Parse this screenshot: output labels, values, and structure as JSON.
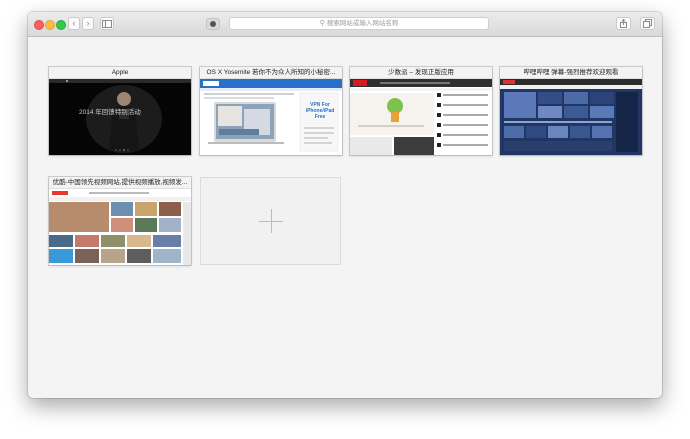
{
  "toolbar": {
    "address_placeholder": "搜索网站或输入网站名称",
    "back_glyph": "‹",
    "forward_glyph": "›"
  },
  "top_sites": [
    {
      "title": "Apple",
      "thumb_text": "2014 年回馈特别活动"
    },
    {
      "title": "OS X Yosemite 若你不为众人所知的小秘密...",
      "thumb_text": "VPN For iPhone/iPad Free"
    },
    {
      "title": "少数派 – 发现正版应用",
      "thumb_text": ""
    },
    {
      "title": "哔哩哔哩 弹幕-强烈推荐欢迎观看",
      "thumb_text": ""
    },
    {
      "title": "优酷-中国领先视频网站,提供视频播放,视频发...",
      "thumb_text": ""
    }
  ],
  "colors": {
    "window_bg": "#f4f4f4",
    "toolbar_top": "#ececec",
    "traffic_red": "#fc605c",
    "traffic_yellow": "#fdbc40",
    "traffic_green": "#34c84a"
  }
}
